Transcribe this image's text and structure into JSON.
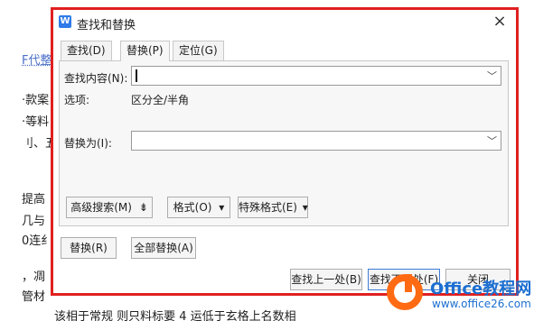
{
  "document": {
    "lines": [
      {
        "text": "F代整",
        "link": true
      },
      {
        "text": "·款案"
      },
      {
        "text": "·等料"
      },
      {
        "text": "刂、五"
      },
      {
        "text": "提高"
      },
      {
        "text": "几与"
      },
      {
        "text": "0连纟"
      },
      {
        "text": "，凋"
      },
      {
        "text": "管材"
      }
    ],
    "bottom_text": "该相于常规    则只料标要 4     运低于玄格上名数相"
  },
  "dialog": {
    "title": "查找和替换",
    "app_icon": "W",
    "close_label": "×",
    "tabs": [
      {
        "label": "查找(D)"
      },
      {
        "label": "替换(P)"
      },
      {
        "label": "定位(G)"
      }
    ],
    "active_tab": "替换(P)",
    "find": {
      "label": "查找内容(N):",
      "value": ""
    },
    "options": {
      "label": "选项:",
      "value": "区分全/半角"
    },
    "replace": {
      "label": "替换为(I):",
      "value": ""
    },
    "buttons": {
      "advanced": "高级搜索(M)",
      "advanced_arrow": "⇟",
      "format": "格式(O)",
      "format_arrow": "▾",
      "special": "特殊格式(E)",
      "special_arrow": "▾",
      "replace": "替换(R)",
      "replace_all": "全部替换(A)",
      "find_prev": "查找上一处(B)",
      "find_next": "查找下一处(F)",
      "close": "关闭"
    },
    "chevron": "﹀"
  },
  "watermark": {
    "brand": "Office教程网",
    "url": "www.office26.com"
  },
  "colors": {
    "highlight_border": "#e02020",
    "watermark_blue": "#1c6fd1",
    "watermark_orange": "#ff6a13"
  }
}
